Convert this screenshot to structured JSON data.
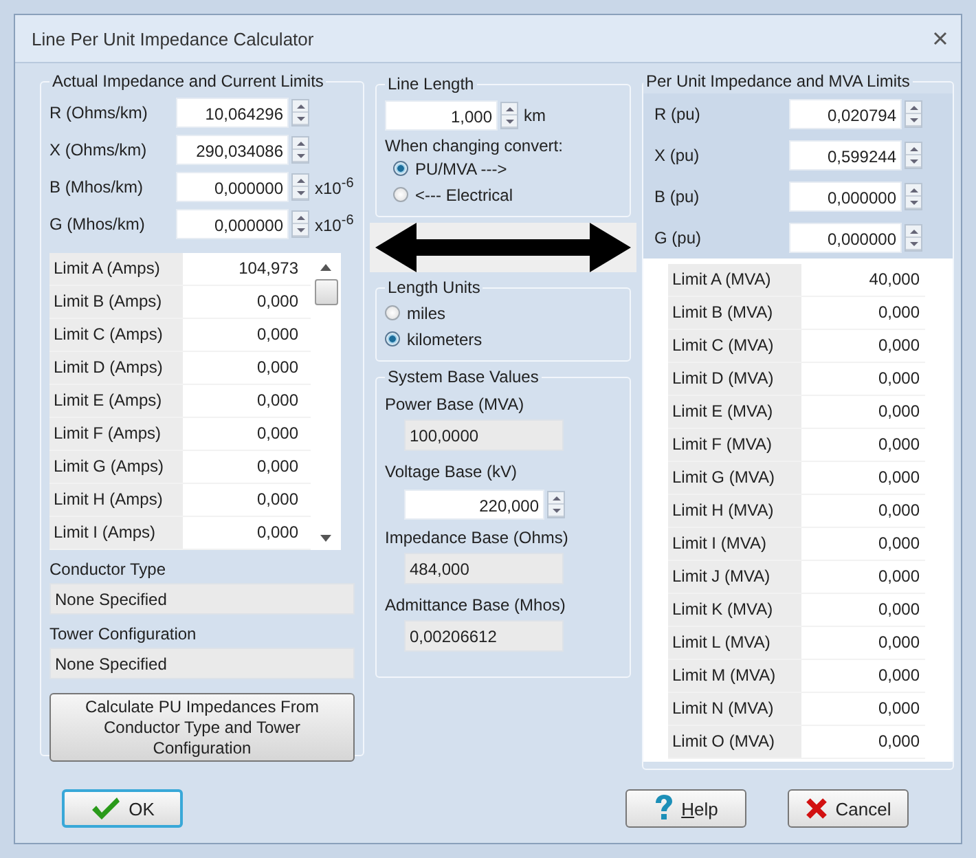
{
  "window": {
    "title": "Line Per Unit Impedance Calculator"
  },
  "actual": {
    "title": "Actual Impedance and Current Limits",
    "fields": [
      {
        "label": "R (Ohms/km)",
        "value": "10,064296"
      },
      {
        "label": "X (Ohms/km)",
        "value": "290,034086"
      },
      {
        "label": "B (Mhos/km)",
        "value": "0,000000",
        "unit": "x10$^{-6}$"
      },
      {
        "label": "G (Mhos/km)",
        "value": "0,000000",
        "unit": "x10$^{-6}$"
      }
    ],
    "limits": [
      {
        "label": "Limit A (Amps)",
        "value": "104,973"
      },
      {
        "label": "Limit B (Amps)",
        "value": "0,000"
      },
      {
        "label": "Limit C (Amps)",
        "value": "0,000"
      },
      {
        "label": "Limit D (Amps)",
        "value": "0,000"
      },
      {
        "label": "Limit E (Amps)",
        "value": "0,000"
      },
      {
        "label": "Limit F (Amps)",
        "value": "0,000"
      },
      {
        "label": "Limit G (Amps)",
        "value": "0,000"
      },
      {
        "label": "Limit H (Amps)",
        "value": "0,000"
      },
      {
        "label": "Limit I (Amps)",
        "value": "0,000"
      }
    ],
    "conductor_type": {
      "label": "Conductor Type",
      "value": "None Specified"
    },
    "tower_configuration": {
      "label": "Tower Configuration",
      "value": "None Specified"
    },
    "calculate_button": "Calculate PU Impedances From Conductor Type and Tower Configuration"
  },
  "line_length": {
    "title": "Line Length",
    "value": "1,000",
    "unit": "km",
    "convert_label": "When changing convert:",
    "options": [
      {
        "label": "PU/MVA --->",
        "selected": true
      },
      {
        "label": "<--- Electrical",
        "selected": false
      }
    ]
  },
  "length_units": {
    "title": "Length Units",
    "options": [
      {
        "label": "miles",
        "selected": false
      },
      {
        "label": "kilometers",
        "selected": true
      }
    ]
  },
  "system_base": {
    "title": "System Base Values",
    "fields": [
      {
        "label": "Power Base (MVA)",
        "value": "100,0000",
        "kind": "readonly"
      },
      {
        "label": "Voltage Base (kV)",
        "value": "220,000",
        "kind": "spin"
      },
      {
        "label": "Impedance Base (Ohms)",
        "value": "484,000",
        "kind": "readonly"
      },
      {
        "label": "Admittance Base (Mhos)",
        "value": "0,00206612",
        "kind": "readonly"
      }
    ]
  },
  "per_unit": {
    "title": "Per Unit Impedance and MVA Limits",
    "fields": [
      {
        "label": "R (pu)",
        "value": "0,020794"
      },
      {
        "label": "X (pu)",
        "value": "0,599244"
      },
      {
        "label": "B (pu)",
        "value": "0,000000"
      },
      {
        "label": "G (pu)",
        "value": "0,000000"
      }
    ],
    "limits": [
      {
        "label": "Limit A (MVA)",
        "value": "40,000"
      },
      {
        "label": "Limit B (MVA)",
        "value": "0,000"
      },
      {
        "label": "Limit C (MVA)",
        "value": "0,000"
      },
      {
        "label": "Limit D (MVA)",
        "value": "0,000"
      },
      {
        "label": "Limit E (MVA)",
        "value": "0,000"
      },
      {
        "label": "Limit F (MVA)",
        "value": "0,000"
      },
      {
        "label": "Limit G (MVA)",
        "value": "0,000"
      },
      {
        "label": "Limit H (MVA)",
        "value": "0,000"
      },
      {
        "label": "Limit I (MVA)",
        "value": "0,000"
      },
      {
        "label": "Limit J (MVA)",
        "value": "0,000"
      },
      {
        "label": "Limit K (MVA)",
        "value": "0,000"
      },
      {
        "label": "Limit L (MVA)",
        "value": "0,000"
      },
      {
        "label": "Limit M (MVA)",
        "value": "0,000"
      },
      {
        "label": "Limit N (MVA)",
        "value": "0,000"
      },
      {
        "label": "Limit O (MVA)",
        "value": "0,000"
      }
    ]
  },
  "buttons": [
    {
      "label": "OK",
      "kind": "ok"
    },
    {
      "label": "Help",
      "kind": "help"
    },
    {
      "label": "Cancel",
      "kind": "cancel"
    }
  ]
}
